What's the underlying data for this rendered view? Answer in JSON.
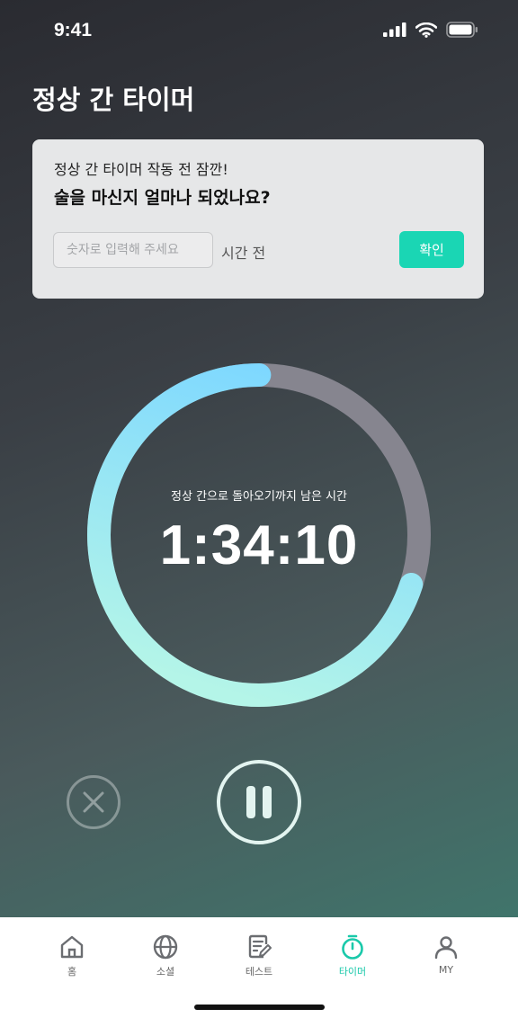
{
  "status_bar": {
    "time": "9:41"
  },
  "page": {
    "title": "정상 간 타이머"
  },
  "prompt_card": {
    "subtitle": "정상 간 타이머 작동 전 잠깐!",
    "question": "술을 마신지 얼마나 되었나요?",
    "input_placeholder": "숫자로 입력해 주세요",
    "input_value": "",
    "unit_label": "시간 전",
    "confirm_label": "확인"
  },
  "timer": {
    "caption": "정상 간으로 돌아오기까지 남은 시간",
    "remaining": "1:34:10",
    "progress_fraction": 0.7
  },
  "controls": {
    "cancel_icon": "close-icon",
    "pause_icon": "pause-icon"
  },
  "tab_bar": {
    "active_index": 3,
    "tabs": [
      {
        "label": "홈",
        "icon": "home-icon"
      },
      {
        "label": "소셜",
        "icon": "globe-icon"
      },
      {
        "label": "테스트",
        "icon": "test-sheet-icon"
      },
      {
        "label": "타이머",
        "icon": "timer-icon"
      },
      {
        "label": "MY",
        "icon": "person-icon"
      }
    ]
  },
  "colors": {
    "accent": "#1AD6B4",
    "ring_start": "#7ED8FF",
    "ring_end": "#B4F5E8",
    "ring_track": "#86858F"
  }
}
